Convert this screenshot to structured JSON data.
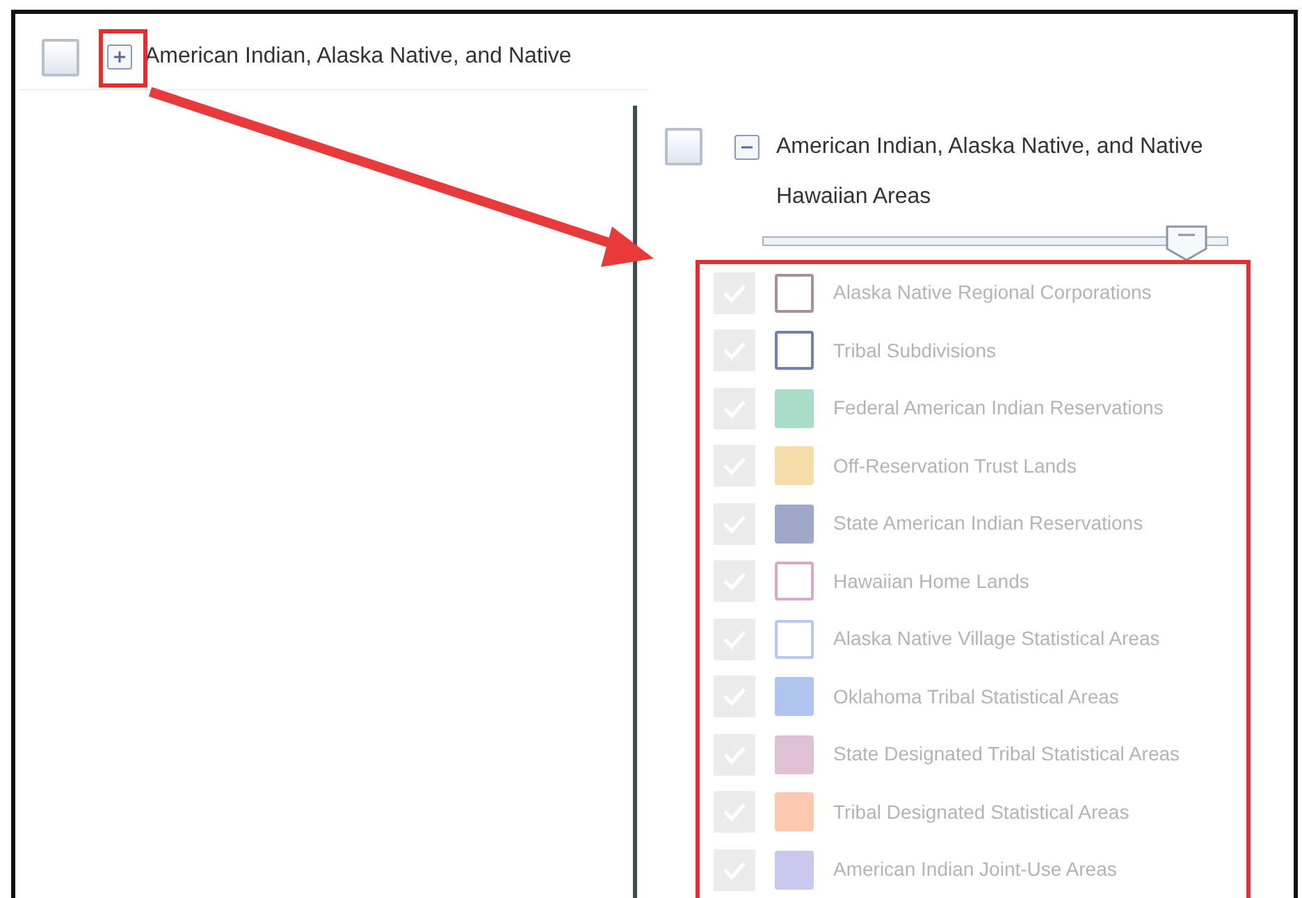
{
  "collapsed_layer": {
    "checked": false,
    "expanded": false,
    "label": "American Indian, Alaska Native, and Native"
  },
  "expanded_layer": {
    "checked": false,
    "expanded": true,
    "label": "American Indian, Alaska Native, and Native Hawaiian Areas",
    "opacity": {
      "level": 0.95
    },
    "sublayers": [
      {
        "label": "Alaska Native Regional Corporations",
        "checked": true,
        "disabled": true,
        "kind": "outline",
        "color": "#a89098"
      },
      {
        "label": "Tribal Subdivisions",
        "checked": true,
        "disabled": true,
        "kind": "outline",
        "color": "#6f80b0"
      },
      {
        "label": "Federal American Indian Reservations",
        "checked": true,
        "disabled": true,
        "kind": "fill",
        "color": "#a8dcc8"
      },
      {
        "label": "Off-Reservation Trust Lands",
        "checked": true,
        "disabled": true,
        "kind": "fill",
        "color": "#f5deaa"
      },
      {
        "label": "State American Indian Reservations",
        "checked": true,
        "disabled": true,
        "kind": "fill",
        "color": "#a0a8c8"
      },
      {
        "label": "Hawaiian Home Lands",
        "checked": true,
        "disabled": true,
        "kind": "outline",
        "color": "#d8a8c8"
      },
      {
        "label": "Alaska Native Village Statistical Areas",
        "checked": true,
        "disabled": true,
        "kind": "outline",
        "color": "#b8c8f0"
      },
      {
        "label": "Oklahoma Tribal Statistical Areas",
        "checked": true,
        "disabled": true,
        "kind": "fill",
        "color": "#b0c4f0"
      },
      {
        "label": "State Designated Tribal Statistical Areas",
        "checked": true,
        "disabled": true,
        "kind": "fill",
        "color": "#e0c0d4"
      },
      {
        "label": "Tribal Designated Statistical Areas",
        "checked": true,
        "disabled": true,
        "kind": "fill",
        "color": "#fcc8b0"
      },
      {
        "label": "American Indian Joint-Use Areas",
        "checked": true,
        "disabled": true,
        "kind": "fill",
        "color": "#c8c8f0"
      }
    ]
  }
}
